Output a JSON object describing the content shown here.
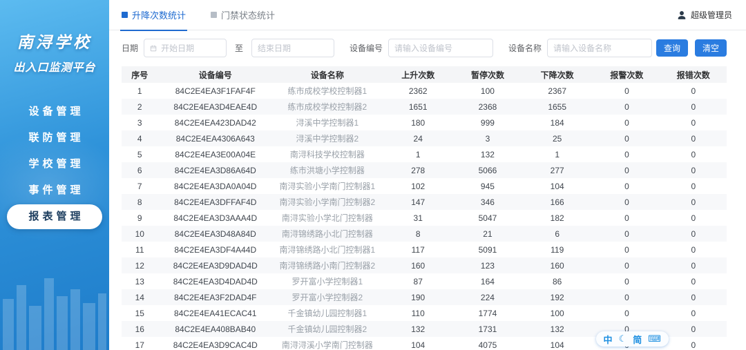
{
  "theme": {
    "accent": "#1f6bd0",
    "sidebar_top": "#5cbbf0",
    "sidebar_bottom": "#1e7cca",
    "button": "#2a7ce0"
  },
  "sidebar": {
    "title_line1": "南浔学校",
    "title_line2": "出入口监测平台",
    "items": [
      {
        "label": "设备管理",
        "active": false
      },
      {
        "label": "联防管理",
        "active": false
      },
      {
        "label": "学校管理",
        "active": false
      },
      {
        "label": "事件管理",
        "active": false
      },
      {
        "label": "报表管理",
        "active": true
      }
    ]
  },
  "header": {
    "tabs": [
      {
        "label": "升降次数统计",
        "active": true
      },
      {
        "label": "门禁状态统计",
        "active": false
      }
    ],
    "user": "超级管理员"
  },
  "filters": {
    "date_label": "日期",
    "date_start_placeholder": "开始日期",
    "date_separator": "至",
    "date_end_placeholder": "结束日期",
    "device_code_label": "设备编号",
    "device_code_placeholder": "请输入设备编号",
    "device_name_label": "设备名称",
    "device_name_placeholder": "请输入设备名称",
    "search_button": "查询",
    "clear_button": "清空"
  },
  "table": {
    "columns": [
      "序号",
      "设备编号",
      "设备名称",
      "上升次数",
      "暂停次数",
      "下降次数",
      "报警次数",
      "报错次数"
    ],
    "rows": [
      [
        1,
        "84C2E4EA3F1FAF4F",
        "练市成校学校控制器1",
        2362,
        100,
        2367,
        0,
        0
      ],
      [
        2,
        "84C2E4EA3D4EAE4D",
        "练市成校学校控制器2",
        1651,
        2368,
        1655,
        0,
        0
      ],
      [
        3,
        "84C2E4EA423DAD42",
        "浔溪中学控制器1",
        180,
        999,
        184,
        0,
        0
      ],
      [
        4,
        "84C2E4EA4306A643",
        "浔溪中学控制器2",
        24,
        3,
        25,
        0,
        0
      ],
      [
        5,
        "84C2E4EA3E00A04E",
        "南浔科技学校控制器",
        1,
        132,
        1,
        0,
        0
      ],
      [
        6,
        "84C2E4EA3D86A64D",
        "练市洪塘小学控制器",
        278,
        5066,
        277,
        0,
        0
      ],
      [
        7,
        "84C2E4EA3DA0A04D",
        "南浔实验小学南门控制器1",
        102,
        945,
        104,
        0,
        0
      ],
      [
        8,
        "84C2E4EA3DFFAF4D",
        "南浔实验小学南门控制器2",
        147,
        346,
        166,
        0,
        0
      ],
      [
        9,
        "84C2E4EA3D3AAA4D",
        "南浔实验小学北门控制器",
        31,
        5047,
        182,
        0,
        0
      ],
      [
        10,
        "84C2E4EA3D48A84D",
        "南浔锦绣路小北门控制器",
        8,
        21,
        6,
        0,
        0
      ],
      [
        11,
        "84C2E4EA3DF4A44D",
        "南浔锦绣路小北门控制器1",
        117,
        5091,
        119,
        0,
        0
      ],
      [
        12,
        "84C2E4EA3D9DAD4D",
        "南浔锦绣路小南门控制器2",
        160,
        123,
        160,
        0,
        0
      ],
      [
        13,
        "84C2E4EA3D4DAD4D",
        "罗开富小学控制器1",
        87,
        164,
        86,
        0,
        0
      ],
      [
        14,
        "84C2E4EA3F2DAD4F",
        "罗开富小学控制器2",
        190,
        224,
        192,
        0,
        0
      ],
      [
        15,
        "84C2E4EA41ECAC41",
        "千金镇幼儿园控制器1",
        110,
        1774,
        100,
        0,
        0
      ],
      [
        16,
        "84C2E4EA408BAB40",
        "千金镇幼儿园控制器2",
        132,
        1731,
        132,
        0,
        0
      ],
      [
        17,
        "84C2E4EA3D9CAC4D",
        "南浔浔溪小学南门控制器",
        104,
        4075,
        104,
        0,
        0
      ]
    ]
  },
  "ime": {
    "lang": "中",
    "moon": "☾",
    "mode": "简",
    "keyboard": "⌨"
  }
}
